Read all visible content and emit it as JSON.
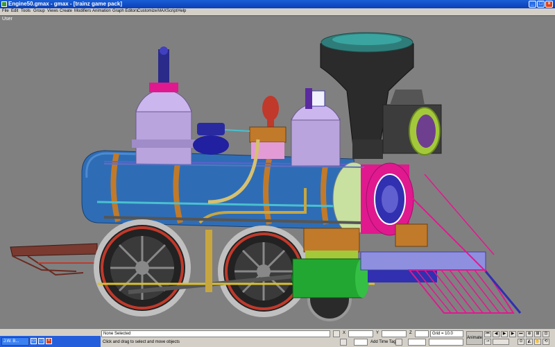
{
  "window": {
    "title": "Engine50.gmax - gmax - [trainz game pack]",
    "controls": [
      "_",
      "□",
      "×"
    ]
  },
  "menu": [
    "File",
    "Edit",
    "Tools",
    "Group",
    "Views",
    "Create",
    "Modifiers",
    "Animation",
    "Graph Editors",
    "Customize",
    "MAXScript",
    "Help"
  ],
  "viewport": {
    "label": "User"
  },
  "status": {
    "selection": "None Selected",
    "prompt": "Click and drag to select and move objects",
    "axis_x": "X",
    "axis_y": "Y",
    "axis_z": "Z",
    "grid": "Grid = 10.0",
    "add_time_tag": "Add Time Tag",
    "animate": "Animate"
  },
  "taskbar": {
    "item": "J.W. B..."
  },
  "colors": {
    "viewport_bg": "#808080",
    "titlebar": "#0a3fb8",
    "boiler": "#2e6db5",
    "band": "#c07a2a",
    "magenta": "#e0198f"
  }
}
